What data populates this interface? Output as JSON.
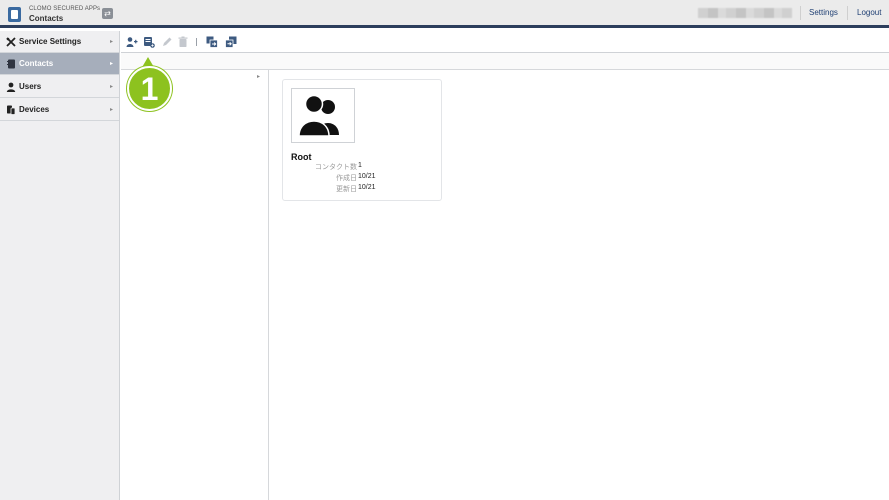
{
  "header": {
    "app_subtitle": "CLOMO SECURED APPs",
    "app_title": "Contacts",
    "settings_label": "Settings",
    "logout_label": "Logout"
  },
  "sidebar": {
    "items": [
      {
        "label": "Service Settings",
        "icon": "tools-icon",
        "active": false
      },
      {
        "label": "Contacts",
        "icon": "contacts-book-icon",
        "active": true
      },
      {
        "label": "Users",
        "icon": "user-icon",
        "active": false
      },
      {
        "label": "Devices",
        "icon": "devices-icon",
        "active": false
      }
    ]
  },
  "toolbar": {
    "buttons": [
      {
        "icon": "add-contact-icon",
        "enabled": true
      },
      {
        "icon": "add-group-icon",
        "enabled": true
      },
      {
        "icon": "edit-icon",
        "enabled": false
      },
      {
        "icon": "trash-icon",
        "enabled": false
      },
      {
        "icon": "import-icon",
        "enabled": true
      },
      {
        "icon": "export-icon",
        "enabled": true
      }
    ]
  },
  "card": {
    "name": "Root",
    "meta": [
      {
        "key": "コンタクト数",
        "value": "1"
      },
      {
        "key": "作成日",
        "value": "10/21"
      },
      {
        "key": "更新日",
        "value": "10/21"
      }
    ]
  },
  "callout": {
    "number": "1",
    "color": "#8dc21f"
  },
  "colors": {
    "header_border": "#2c3e5c",
    "active_nav": "#a6aebb",
    "link": "#1f3f73"
  }
}
